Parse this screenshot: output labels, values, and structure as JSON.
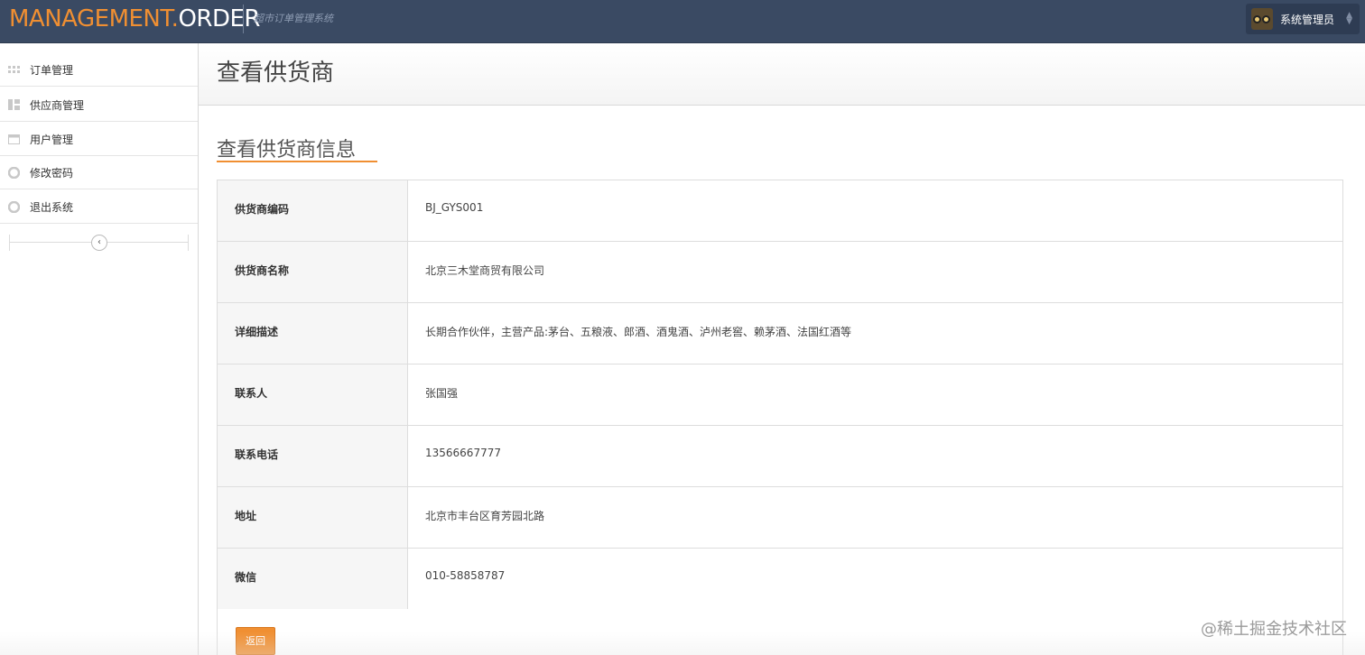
{
  "header": {
    "brand_part1": "MANAGEMENT.",
    "brand_part2": "ORDER",
    "subtitle": "超市订单管理系统",
    "user_name": "系统管理员",
    "colors": {
      "navbar": "#3a4a63",
      "accent": "#f08f32"
    }
  },
  "sidebar": {
    "items": [
      {
        "label": "订单管理",
        "icon": "grid-icon"
      },
      {
        "label": "供应商管理",
        "icon": "layout-icon"
      },
      {
        "label": "用户管理",
        "icon": "calendar-icon"
      },
      {
        "label": "修改密码",
        "icon": "lifebuoy-icon"
      },
      {
        "label": "退出系统",
        "icon": "lifebuoy-icon"
      }
    ],
    "collapse_icon": "chevron-left-icon"
  },
  "page": {
    "title": "查看供货商",
    "section_title": "查看供货商信息"
  },
  "supplier": {
    "rows": [
      {
        "label": "供货商编码",
        "value": "BJ_GYS001"
      },
      {
        "label": "供货商名称",
        "value": "北京三木堂商贸有限公司"
      },
      {
        "label": "详细描述",
        "value": "长期合作伙伴，主营产品:茅台、五粮液、郎酒、酒鬼酒、泸州老窖、赖茅酒、法国红酒等"
      },
      {
        "label": "联系人",
        "value": "张国强"
      },
      {
        "label": "联系电话",
        "value": "13566667777"
      },
      {
        "label": "地址",
        "value": "北京市丰台区育芳园北路"
      },
      {
        "label": "微信",
        "value": "010-58858787"
      }
    ]
  },
  "actions": {
    "back_label": "返回"
  },
  "watermark": "@稀土掘金技术社区"
}
